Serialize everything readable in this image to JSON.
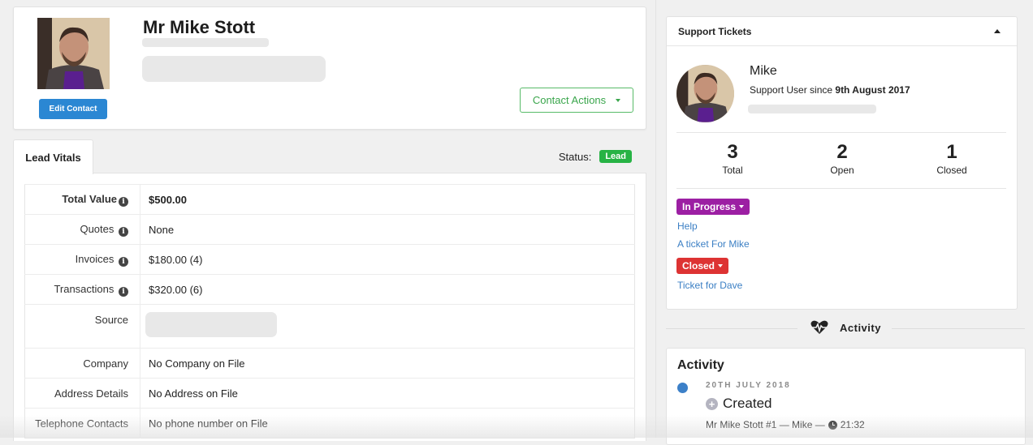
{
  "contact": {
    "name": "Mr Mike Stott",
    "edit_label": "Edit Contact",
    "actions_label": "Contact Actions"
  },
  "tabs": [
    {
      "label": "Lead Vitals",
      "active": true
    }
  ],
  "status": {
    "label": "Status:",
    "value": "Lead",
    "color": "#27b345"
  },
  "vitals": [
    {
      "label": "Total Value",
      "value": "$500.00",
      "info": true,
      "bold": true
    },
    {
      "label": "Quotes",
      "value": "None",
      "info": true
    },
    {
      "label": "Invoices",
      "value": "$180.00 (4)",
      "info": true
    },
    {
      "label": "Transactions",
      "value": "$320.00 (6)",
      "info": true
    },
    {
      "label": "Source",
      "value": "",
      "redacted": true
    },
    {
      "label": "Company",
      "value": "No Company on File"
    },
    {
      "label": "Address Details",
      "value": "No Address on File"
    },
    {
      "label": "Telephone Contacts",
      "value": "No phone number on File"
    }
  ],
  "support": {
    "title": "Support Tickets",
    "user_name": "Mike",
    "since_prefix": "Support User since ",
    "since_date": "9th August 2017",
    "stats": [
      {
        "value": "3",
        "label": "Total"
      },
      {
        "value": "2",
        "label": "Open"
      },
      {
        "value": "1",
        "label": "Closed"
      }
    ],
    "groups": [
      {
        "status": "In Progress",
        "color": "#9c1fa3",
        "tickets": [
          "Help",
          "A ticket For Mike"
        ]
      },
      {
        "status": "Closed",
        "color": "#dd3333",
        "tickets": [
          "Ticket for Dave"
        ]
      }
    ]
  },
  "activity": {
    "divider_label": "Activity",
    "title": "Activity",
    "entries": [
      {
        "date": "20TH JULY 2018",
        "event": "Created",
        "meta_prefix": "Mr Mike Stott #1 — Mike —",
        "time": "21:32"
      }
    ]
  },
  "icons": {
    "info": "info-circle-icon",
    "caret": "caret-down-icon",
    "collapse": "caret-up-icon",
    "activity": "heartbeat-icon",
    "event": "plus-circle-icon",
    "time": "clock-icon"
  }
}
